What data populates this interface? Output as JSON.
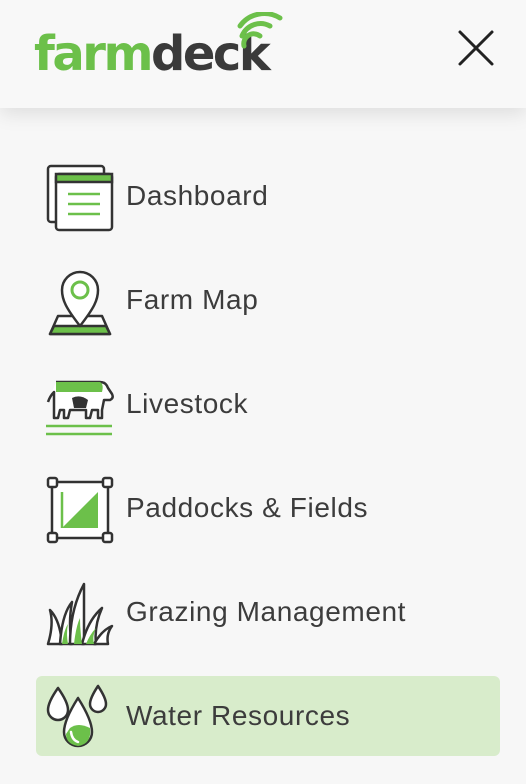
{
  "brand": {
    "logo_part1": "farm",
    "logo_part2": "deck",
    "accent_color": "#6cc04a",
    "dark_color": "#3a3a3a"
  },
  "header": {
    "close_icon": "close-icon"
  },
  "menu": {
    "items": [
      {
        "label": "Dashboard",
        "icon": "dashboard-icon",
        "active": false
      },
      {
        "label": "Farm Map",
        "icon": "map-pin-icon",
        "active": false
      },
      {
        "label": "Livestock",
        "icon": "cow-icon",
        "active": false
      },
      {
        "label": "Paddocks & Fields",
        "icon": "paddock-icon",
        "active": false
      },
      {
        "label": "Grazing Management",
        "icon": "grass-icon",
        "active": false
      },
      {
        "label": "Water Resources",
        "icon": "water-drops-icon",
        "active": true
      }
    ],
    "active_background": "#d8eccb"
  }
}
